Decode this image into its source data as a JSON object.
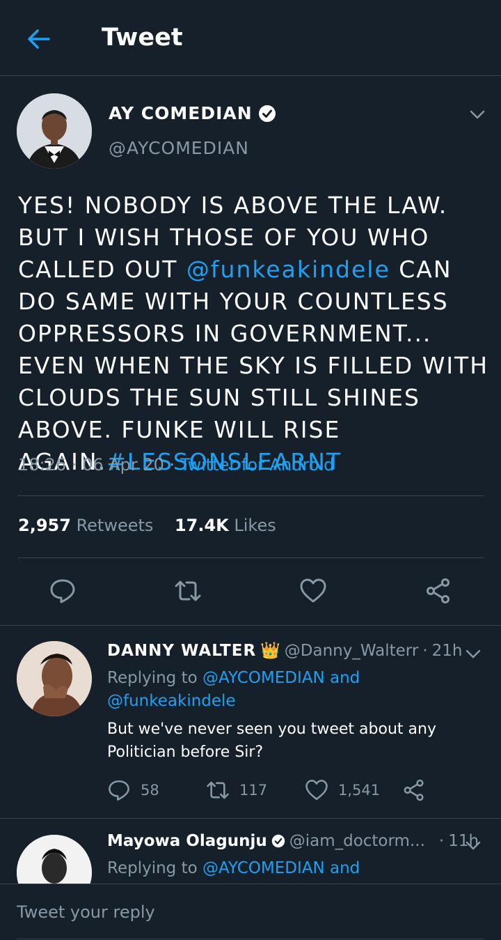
{
  "header": {
    "title": "Tweet"
  },
  "tweet": {
    "author": "AY COMEDIAN",
    "handle": "@AYCOMEDIAN",
    "text_1": "YES! NOBODY IS ABOVE THE LAW. BUT I WISH THOSE OF YOU WHO CALLED OUT ",
    "mention": "@funkeakindele",
    "text_2": "  CAN DO SAME WITH YOUR COUNTLESS OPPRESSORS IN GOVERNMENT... EVEN WHEN THE SKY IS FILLED WITH CLOUDS THE SUN STILL SHINES ABOVE. FUNKE WILL RISE AGAIN.",
    "hashtag": "#LESSONSLEARNT",
    "time": "18:26",
    "date": "06 Apr 20",
    "source": "Twitter for Android",
    "retweets": "2,957",
    "retweets_label": "Retweets",
    "likes": "17.4K",
    "likes_label": "Likes"
  },
  "replies": [
    {
      "name": "DANNY WALTER",
      "badge": "👑",
      "handle": "@Danny_Walterr",
      "time": "21h",
      "replying_prefix": "Replying to",
      "replying_1": "@AYCOMEDIAN and",
      "replying_2": "@funkeakindele",
      "text": "But we've never seen you tweet about any Politician before Sir?",
      "comments": "58",
      "retweets": "117",
      "likes": "1,541"
    },
    {
      "name": "Mayowa Olagunju",
      "handle": "@iam_doctorm...",
      "time": "11h",
      "replying_prefix": "Replying to",
      "replying_1": "@AYCOMEDIAN and"
    }
  ],
  "reply_bar": {
    "placeholder": "Tweet your reply"
  },
  "colors": {
    "background": "#15202b",
    "accent": "#1da1f2",
    "muted": "#8899a6",
    "divider": "#38444d"
  }
}
